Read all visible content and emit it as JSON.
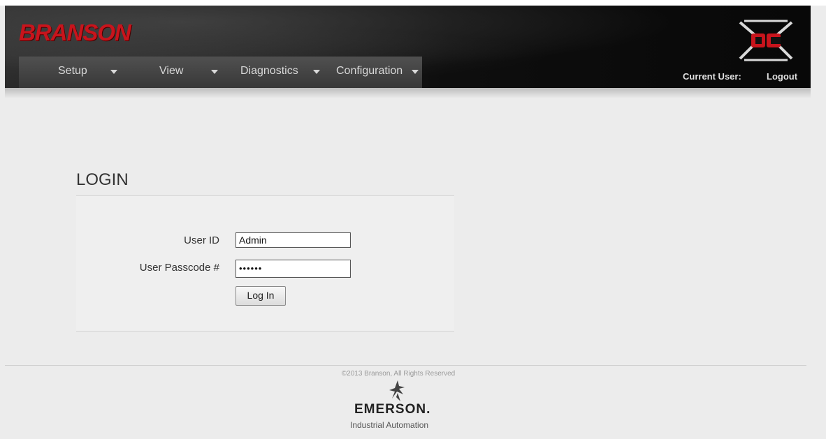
{
  "header": {
    "brand": "BRANSON",
    "product_logo": "DC-X logo",
    "nav": [
      {
        "label": "Setup"
      },
      {
        "label": "View"
      },
      {
        "label": "Diagnostics"
      },
      {
        "label": "Configuration"
      }
    ],
    "current_user_label": "Current User:",
    "logout_label": "Logout"
  },
  "login": {
    "title": "LOGIN",
    "user_id_label": "User ID",
    "user_id_value": "Admin",
    "passcode_label": "User Passcode #",
    "passcode_value": "••••••",
    "button_label": "Log In"
  },
  "footer": {
    "copyright": "©2013 Branson, All Rights Reserved",
    "company": "EMERSON.",
    "division": "Industrial Automation"
  },
  "colors": {
    "brand_red": "#c8141c",
    "header_bg": "#111111",
    "navbar_bg": "#444444",
    "page_bg": "#ececec"
  },
  "icons": [
    "caret-down-icon",
    "dc-x-logo-icon",
    "emerson-logo-icon"
  ]
}
